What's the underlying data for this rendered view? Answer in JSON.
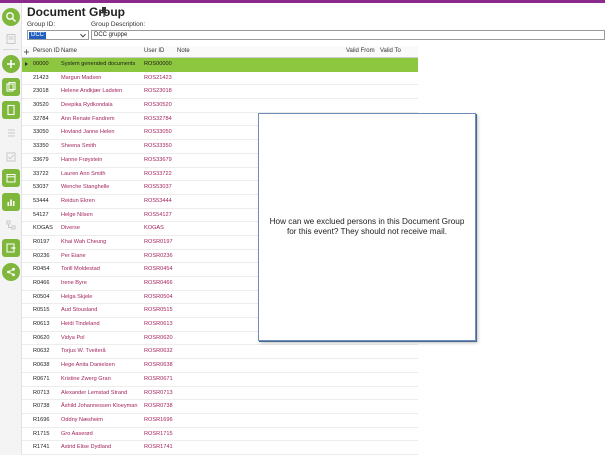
{
  "header": {
    "title": "Document Group",
    "group_id_label": "Group ID:",
    "group_id_value": "DCC",
    "group_desc_label": "Group Description:",
    "group_desc_value": "DCC gruppe"
  },
  "grid": {
    "columns": [
      "Person ID",
      "Name",
      "User ID",
      "Note",
      "Valid From",
      "Valid To"
    ],
    "rows": [
      {
        "person_id": "00000",
        "name": "System generated documents",
        "user_id": "ROS00000"
      },
      {
        "person_id": "21423",
        "name": "Margun Madsen",
        "user_id": "ROS21423"
      },
      {
        "person_id": "23018",
        "name": "Helene Andkjær Ladsten",
        "user_id": "ROS23018"
      },
      {
        "person_id": "30520",
        "name": "Deepika Rydkondala",
        "user_id": "ROS30520"
      },
      {
        "person_id": "32784",
        "name": "Ann Renate Fandrem",
        "user_id": "ROS32784"
      },
      {
        "person_id": "33050",
        "name": "Hovland Janne Helen",
        "user_id": "ROS33050"
      },
      {
        "person_id": "33350",
        "name": "Sheena Smith",
        "user_id": "ROS33350"
      },
      {
        "person_id": "33679",
        "name": "Hanne Frøystein",
        "user_id": "ROS33679"
      },
      {
        "person_id": "33722",
        "name": "Lauren Ann Smith",
        "user_id": "ROS33722"
      },
      {
        "person_id": "53037",
        "name": "Wenche Stanghelle",
        "user_id": "ROS53037"
      },
      {
        "person_id": "53444",
        "name": "Reidun Ekren",
        "user_id": "ROS53444"
      },
      {
        "person_id": "54127",
        "name": "Helge Nilsen",
        "user_id": "ROS54127"
      },
      {
        "person_id": "KOGAS",
        "name": "Diverse",
        "user_id": "KOGAS"
      },
      {
        "person_id": "R0197",
        "name": "Khai Wah Cheung",
        "user_id": "ROSR0197"
      },
      {
        "person_id": "R0236",
        "name": "Per Eiane",
        "user_id": "ROSR0236"
      },
      {
        "person_id": "R0454",
        "name": "Torill Moldestad",
        "user_id": "ROSR0454"
      },
      {
        "person_id": "R0466",
        "name": "Irene Byre",
        "user_id": "ROSR0466"
      },
      {
        "person_id": "R0504",
        "name": "Helga Skjele",
        "user_id": "ROSR0504"
      },
      {
        "person_id": "R0515",
        "name": "Aud Stousland",
        "user_id": "ROSR0515"
      },
      {
        "person_id": "R0613",
        "name": "Heidi Tindeland",
        "user_id": "ROSR0613"
      },
      {
        "person_id": "R0620",
        "name": "Vidya Pol",
        "user_id": "ROSR0620"
      },
      {
        "person_id": "R0632",
        "name": "Torjus W. Tveiterå",
        "user_id": "ROSR0632"
      },
      {
        "person_id": "R0638",
        "name": "Hege Anita Danielsen",
        "user_id": "ROSR0638"
      },
      {
        "person_id": "R0671",
        "name": "Kristine Zwerg Gran",
        "user_id": "ROSR0671"
      },
      {
        "person_id": "R0713",
        "name": "Alexander Lemstad Strand",
        "user_id": "ROSR0713"
      },
      {
        "person_id": "R0738",
        "name": "Åshild Johannessen Kloeyman",
        "user_id": "ROSR0738"
      },
      {
        "person_id": "R1696",
        "name": "Oddny Næsheim",
        "user_id": "ROSR1696"
      },
      {
        "person_id": "R1715",
        "name": "Gro Aaserød",
        "user_id": "ROSR1715"
      },
      {
        "person_id": "R1741",
        "name": "Astrid Elise Dydland",
        "user_id": "ROSR1741"
      }
    ]
  },
  "note": {
    "text": "How can we exclued persons in this Document Group for this event? They should not receive mail."
  },
  "colors": {
    "accent": "#8a2a8c",
    "toolbar_green": "#7fb73d",
    "selected_row": "#8dc63f",
    "link_text": "#a3245e"
  },
  "icons": [
    "search-icon",
    "add-icon",
    "copy-icon",
    "document-icon",
    "list-icon",
    "calendar-icon",
    "chart-icon",
    "export-icon",
    "tree-icon",
    "pin-icon"
  ]
}
